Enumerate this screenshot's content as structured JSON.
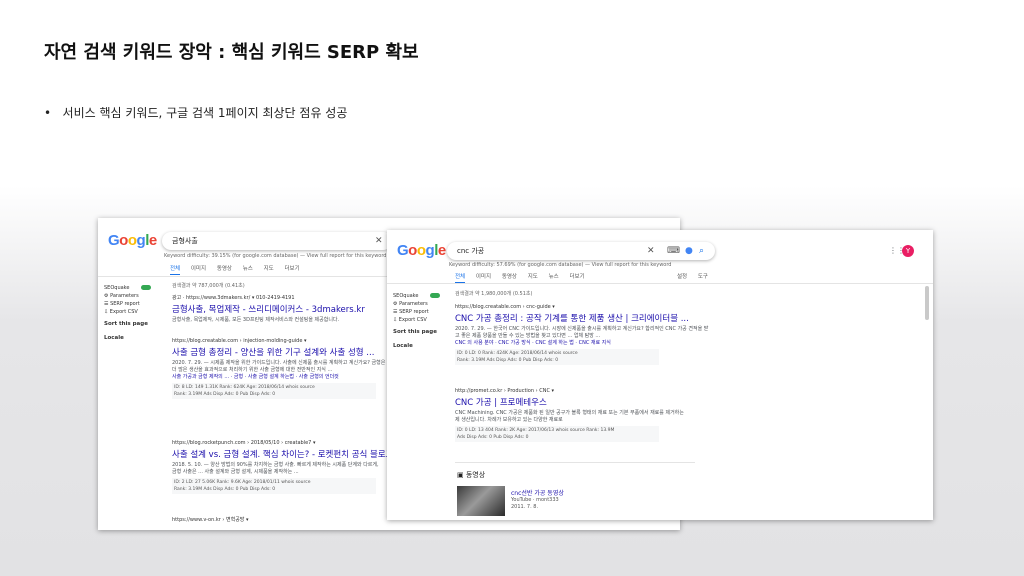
{
  "slide": {
    "title": "자연 검색 키워드 장악 : 핵심 키워드 SERP 확보",
    "bullet": "서비스 핵심 키워드, 구글 검색 1페이지 최상단 점유 성공"
  },
  "shot1": {
    "logo": "Google",
    "query": "금형사출",
    "difficulty": "Keyword difficulty: 39.15% (for google.com database) — View full report for this keyword",
    "tabs": [
      "전체",
      "이미지",
      "동영상",
      "뉴스",
      "지도",
      "더보기"
    ],
    "result_count": "검색결과 약 787,000개 (0.41초)",
    "sidebar": {
      "brand": "SEOquake",
      "items": [
        "Parameters",
        "SERP report",
        "Export CSV"
      ],
      "sort": "Sort this page",
      "locale": "Locale"
    },
    "results": [
      {
        "url": "광고 · https://www.3dmakers.kr/ ▾ 010-2419-4191",
        "title": "금형사출, 목업제작 - 쓰리디메이커스 - 3dmakers.kr",
        "snippet": [
          "금형사출, 목업제작, 시제품, 모든 3D프린팅 제작서비스와 컨설팅을 제공합니다."
        ]
      },
      {
        "url": "https://blog.creatable.com › injection-molding-guide ▾",
        "title": "사출 금형 총정리 - 양산을 위한 기구 설계와 사출 성형 ...",
        "snippet": [
          "2020. 7. 29. — 시제품 제작을 위한 가이드입니다. 사출에 신제품 출시를 계획하고 계신가요? 금형은",
          "더 많은 생산을 효과적으로 처리하기 위한 사출 금형에 대한 전반적인 지식 ..."
        ],
        "links": "사출 가공과 금형 제작의 ... · 금형 · 사출 금형 설계 하는법 · 사출 금형의 언더컷",
        "metrics": [
          "ID: 8   LD: 149   1.31K   Rank: 624K   Age: 2018/06/14   whois   source",
          "Rank: 3.19M   Ads Disp Ads: 0   Pub Disp Ads: 0"
        ]
      },
      {
        "url": "https://blog.rocketpunch.com › 2018/05/10 › creatable7 ▾",
        "title": "사출 설계 vs. 금형 설계. 핵심 차이는? - 로켓펀치 공식 블로그",
        "snippet": [
          "2018. 5. 10. — 양산 방법의 90%를 차지하는 금형 사출. 빠르게 제작하는 시제품 단계와 다르게,",
          "금형 사출은 ... 사출 설계와 금형 설계, 시제품을 제작하는 ..."
        ],
        "metrics": [
          "ID: 2   LD: 27   5.06K   Rank: 9.6K   Age: 2018/01/11   whois   source",
          "Rank: 3.19M   Ads Disp Ads: 0   Pub Disp Ads: 0"
        ]
      },
      {
        "url": "https://www.v-on.kr › 변혁공방 ▾",
        "title": "",
        "snippet": []
      }
    ]
  },
  "shot2": {
    "logo": "Google",
    "query": "cnc 가공",
    "difficulty": "Keyword difficulty: 57.69% (for google.com database) — View full report for this keyword",
    "tabs": [
      "전체",
      "이미지",
      "동영상",
      "지도",
      "뉴스",
      "더보기"
    ],
    "tools": [
      "설정",
      "도구"
    ],
    "avatar": "Y",
    "result_count": "검색결과 약 1,980,000개 (0.51초)",
    "sidebar": {
      "brand": "SEOquake",
      "items": [
        "Parameters",
        "SERP report",
        "Export CSV"
      ],
      "sort": "Sort this page",
      "locale": "Locale"
    },
    "results": [
      {
        "url": "https://blog.creatable.com › cnc-guide ▾",
        "title": "CNC 가공 총정리 : 공작 기계를 통한 제품 생산 | 크리에이터블 ...",
        "snippet": [
          "2020. 7. 29. — 한국어 CNC 가이드입니다. 시장에 신제품을 출시를 계획하고 계신가요? 합리적인 CNC 가공 견적을 받",
          "고 좋은 제품 양품을 만들 수 있는 방법을 찾고 있다면 ... 업체 탐방 ...",
          "CNC 의 사용 분야 · CNC 가공 방식 · CNC 설계 하는 법 · CNC 재료 지식"
        ],
        "metrics": [
          "ID: 0   LD: 0   Rank: 424K   Age: 2018/06/14   whois   source",
          "Rank: 3.19M   Ads Disp Ads: 0   Pub Disp Ads: 0"
        ]
      },
      {
        "url": "http://promet.co.kr › Production › CNC ▾",
        "title": "CNC 가공 | 프로메테우스",
        "snippet": [
          "CNC Machining. CNC 가공은 제품화 된 일반 공구가 블록 형태의 재료 또는 기본 부품에서 재료를 제거하는",
          "제 생산입니다. 차례가 보유하고 있는 다양한 재료로"
        ],
        "metrics": [
          "ID: 0   LD: 13   404   Rank: 2K   Age: 2017/06/13   whois   source   Rank: 13.9M",
          "Ads Disp Ads: 0   Pub Disp Ads: 0"
        ]
      }
    ],
    "videos": {
      "heading": "동영상",
      "items": [
        {
          "title": "cnc선반 가공 동영상",
          "source": "YouTube · mont333",
          "date": "2011. 7. 8."
        }
      ]
    }
  }
}
